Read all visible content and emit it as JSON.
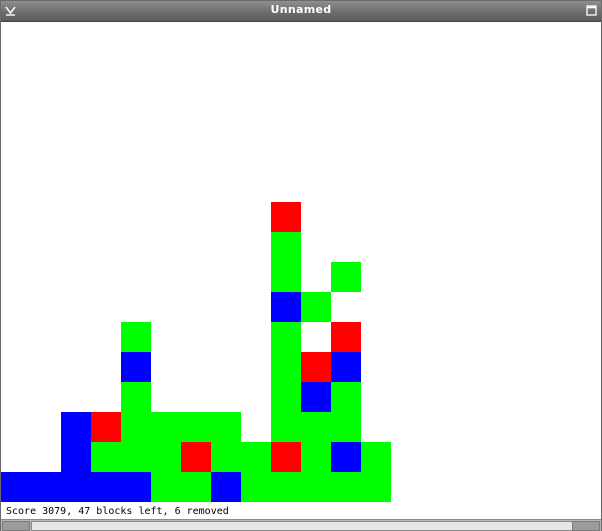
{
  "window": {
    "title": "Unnamed"
  },
  "colors": {
    "g": "#00ff00",
    "r": "#ff0000",
    "b": "#0000ff"
  },
  "board": {
    "columns": 20,
    "rows": 16,
    "grid_bottom_up": [
      "bbbbbggbggggg",
      "  bgggrggrgbg",
      "  brgggg ggg ",
      "    g    gbg ",
      "    b    grb ",
      "    g    g r ",
      "         bg  ",
      "         g g ",
      "         g   ",
      "         r   "
    ]
  },
  "status": {
    "text": "Score 3079, 47 blocks left, 6 removed"
  }
}
